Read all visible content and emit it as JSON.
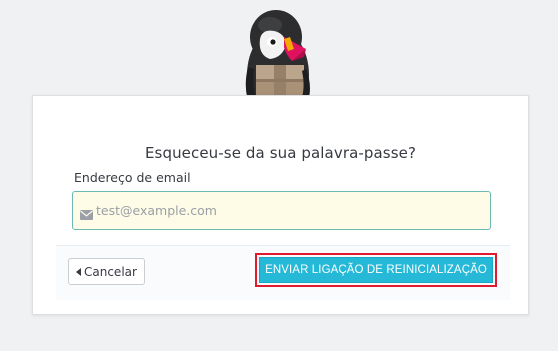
{
  "title": "Esqueceu-se da sua palavra-passe?",
  "email": {
    "label": "Endereço de email",
    "placeholder": "test@example.com",
    "value": ""
  },
  "buttons": {
    "cancel": "Cancelar",
    "submit": "ENVIAR LIGAÇÃO DE REINICIALIZAÇÃO"
  },
  "icons": {
    "email": "envelope-icon",
    "cancel": "caret-left-icon",
    "logo": "puffin-mascot-logo"
  },
  "colors": {
    "page_background": "#eff1f2",
    "primary": "#25b9d7",
    "input_background": "#fefbe7",
    "input_border": "#6cb9b3",
    "highlight": "#e01a2c"
  }
}
